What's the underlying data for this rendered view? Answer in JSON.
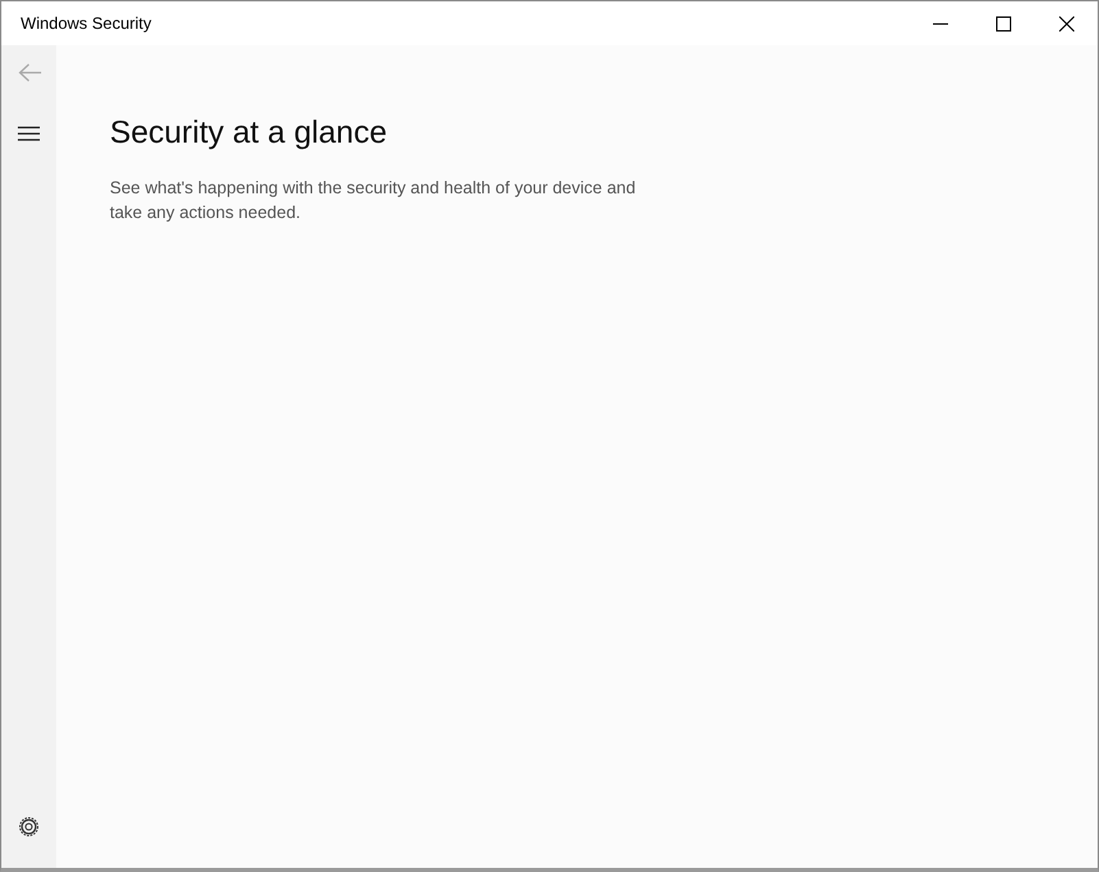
{
  "window": {
    "title": "Windows Security"
  },
  "sidebar": {
    "back": {
      "disabled": true
    }
  },
  "page": {
    "heading": "Security at a glance",
    "description": "See what's happening with the security and health of your device and take any actions needed."
  }
}
